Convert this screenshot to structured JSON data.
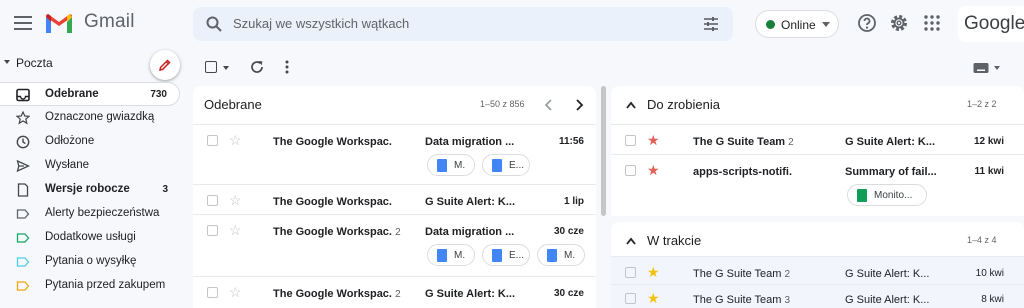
{
  "app": {
    "name": "Gmail"
  },
  "search": {
    "placeholder": "Szukaj we wszystkich wątkach"
  },
  "status": {
    "label": "Online",
    "color": "#188038"
  },
  "brand_right": "Google",
  "sidebar": {
    "section": "Poczta",
    "items": [
      {
        "label": "Odebrane",
        "count": "730",
        "icon": "inbox-icon",
        "active": true,
        "bold": true
      },
      {
        "label": "Oznaczone gwiazdką",
        "count": "",
        "icon": "star-outline-icon"
      },
      {
        "label": "Odłożone",
        "count": "",
        "icon": "clock-icon"
      },
      {
        "label": "Wysłane",
        "count": "",
        "icon": "send-icon"
      },
      {
        "label": "Wersje robocze",
        "count": "3",
        "icon": "draft-icon",
        "bold": true
      },
      {
        "label": "Alerty bezpieczeństwa",
        "count": "",
        "icon": "label-icon",
        "color": "#5f6368"
      },
      {
        "label": "Dodatkowe usługi",
        "count": "",
        "icon": "label-icon",
        "color": "#16a766"
      },
      {
        "label": "Pytania o wysyłkę",
        "count": "",
        "icon": "label-icon",
        "color": "#4ecde6"
      },
      {
        "label": "Pytania przed zakupem",
        "count": "",
        "icon": "label-icon",
        "color": "#f2a60c"
      }
    ]
  },
  "inbox": {
    "title": "Odebrane",
    "range": "1–50 z 856",
    "rows": [
      {
        "sender": "The Google Workspac.",
        "count": "",
        "subject": "Data migration ...",
        "time": "11:56",
        "chips": [
          "M.",
          "E..."
        ]
      },
      {
        "sender": "The Google Workspac.",
        "count": "",
        "subject": "G Suite Alert: K...",
        "time": "1 lip",
        "chips": []
      },
      {
        "sender": "The Google Workspac.",
        "count": "2",
        "subject": "Data migration ...",
        "time": "30 cze",
        "chips": [
          "M.",
          "E...",
          "M."
        ]
      },
      {
        "sender": "The Google Workspac.",
        "count": "2",
        "subject": "G Suite Alert: K...",
        "time": "30 cze",
        "chips": []
      }
    ]
  },
  "todo": {
    "title": "Do zrobienia",
    "range": "1–2 z 2",
    "rows": [
      {
        "sender": "The G Suite Team",
        "count": "2",
        "subject": "G Suite Alert: K...",
        "time": "12 kwi",
        "star": "red",
        "chips": []
      },
      {
        "sender": "apps-scripts-notifi.",
        "count": "",
        "subject": "Summary of fail...",
        "time": "11 kwi",
        "star": "red",
        "chips": [
          "Monito..."
        ]
      }
    ]
  },
  "inprogress": {
    "title": "W trakcie",
    "range": "1–4 z 4",
    "rows": [
      {
        "sender": "The G Suite Team",
        "count": "2",
        "subject": "G Suite Alert: K...",
        "time": "10 kwi",
        "star": "yellow"
      },
      {
        "sender": "The G Suite Team",
        "count": "3",
        "subject": "G Suite Alert: K...",
        "time": "8 kwi",
        "star": "yellow"
      }
    ]
  },
  "colors": {
    "star_red": "#e06055",
    "star_yellow": "#f4c20d",
    "doc_blue": "#4285f4",
    "sheet_green": "#0f9d58"
  }
}
